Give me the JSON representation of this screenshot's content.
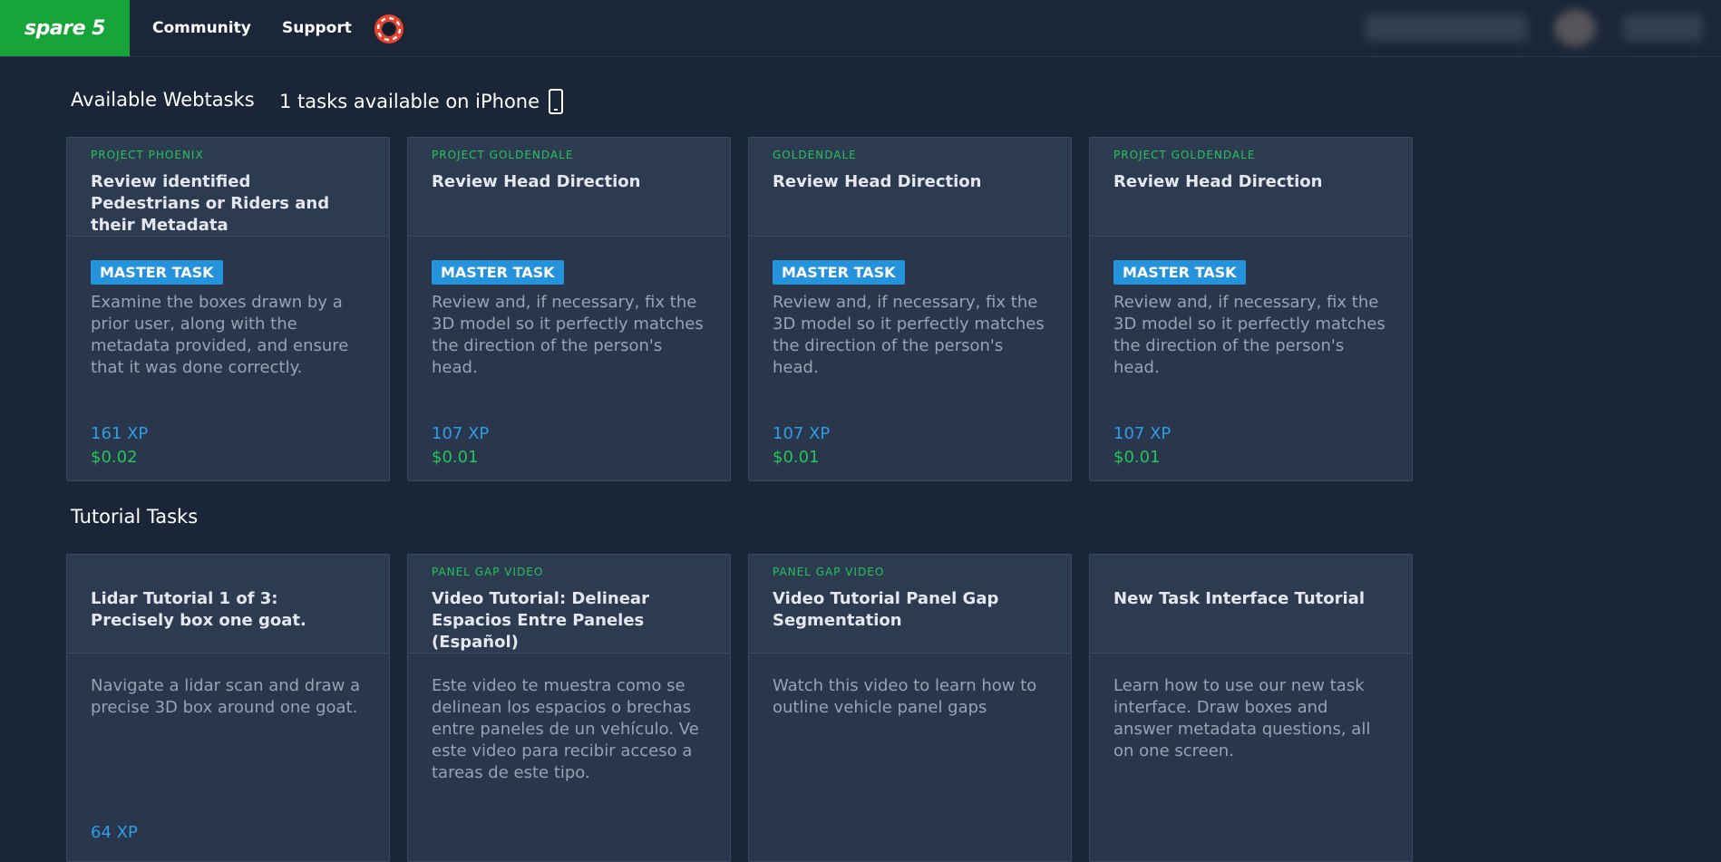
{
  "topbar": {
    "logo": "spare 5",
    "nav": [
      "Community",
      "Support"
    ]
  },
  "available": {
    "title": "Available Webtasks",
    "iphone_text": "1 tasks available on iPhone",
    "cards": [
      {
        "project": "PROJECT PHOENIX",
        "title": "Review identified Pedestrians or Riders and their Metadata",
        "badge": "MASTER TASK",
        "description": "Examine the boxes drawn by a prior user, along with the metadata provided, and ensure that it was done correctly.",
        "xp": "161 XP",
        "price": "$0.02"
      },
      {
        "project": "PROJECT GOLDENDALE",
        "title": "Review Head Direction",
        "badge": "MASTER TASK",
        "description": "Review and, if necessary, fix the 3D model so it perfectly matches the direction of the person's head.",
        "xp": "107 XP",
        "price": "$0.01"
      },
      {
        "project": "GOLDENDALE",
        "title": "Review Head Direction",
        "badge": "MASTER TASK",
        "description": "Review and, if necessary, fix the 3D model so it perfectly matches the direction of the person's head.",
        "xp": "107 XP",
        "price": "$0.01"
      },
      {
        "project": "PROJECT GOLDENDALE",
        "title": "Review Head Direction",
        "badge": "MASTER TASK",
        "description": "Review and, if necessary, fix the 3D model so it perfectly matches the direction of the person's head.",
        "xp": "107 XP",
        "price": "$0.01"
      }
    ]
  },
  "tutorial": {
    "title": "Tutorial Tasks",
    "cards": [
      {
        "project": "",
        "title": "Lidar Tutorial 1 of 3: Precisely box one goat.",
        "description": "Navigate a lidar scan and draw a precise 3D box around one goat.",
        "xp": "64 XP"
      },
      {
        "project": "PANEL GAP VIDEO",
        "title": "Video Tutorial: Delinear Espacios Entre Paneles (Español)",
        "description": "Este video te muestra como se delinean los espacios o brechas entre paneles de un vehículo. Ve este video para recibir acceso a tareas de este tipo.",
        "xp": ""
      },
      {
        "project": "PANEL GAP VIDEO",
        "title": "Video Tutorial Panel Gap Segmentation",
        "description": "Watch this video to learn how to outline vehicle panel gaps",
        "xp": ""
      },
      {
        "project": "",
        "title": "New Task Interface Tutorial",
        "description": "Learn how to use our new task interface. Draw boxes and answer metadata questions, all on one screen.",
        "xp": ""
      }
    ]
  },
  "colors": {
    "background": "#1a2638",
    "logo_green": "#17a53a",
    "project_green": "#25c45a",
    "badge_blue": "#2592dc",
    "xp_blue": "#2f9ee6"
  },
  "icons": [
    "lifebuoy-icon",
    "phone-icon"
  ]
}
